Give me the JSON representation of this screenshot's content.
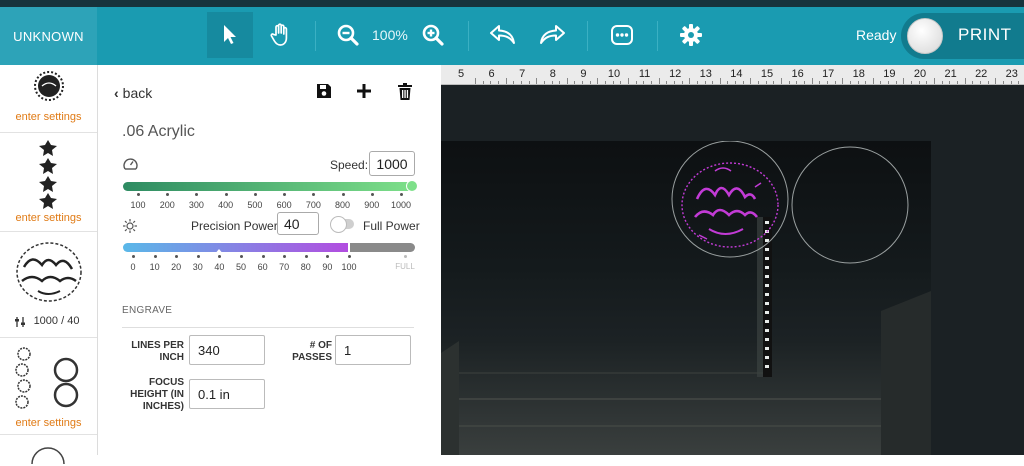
{
  "toolbar": {
    "machine_name": "UNKNOWN",
    "zoom_level": "100%",
    "status": "Ready",
    "print_label": "PRINT",
    "icons": [
      "select-arrow-icon",
      "hand-pan-icon",
      "zoom-out-icon",
      "zoom-in-icon",
      "undo-icon",
      "redo-icon",
      "more-icon",
      "gear-icon"
    ]
  },
  "thumbnails": [
    {
      "caption": "enter settings"
    },
    {
      "caption": "enter settings"
    },
    {
      "caption": "1000 / 40"
    },
    {
      "caption": "enter settings"
    }
  ],
  "panel": {
    "back_label": "back",
    "material": ".06 Acrylic",
    "speed_label": "Speed:",
    "speed_value": "1000",
    "speed_ticks": [
      "100",
      "200",
      "300",
      "400",
      "500",
      "600",
      "700",
      "800",
      "900",
      "1000"
    ],
    "speed_fraction": 1.0,
    "power_label": "Precision Power",
    "power_value": "40",
    "power_fraction": 0.4,
    "power_ticks": [
      "0",
      "10",
      "20",
      "30",
      "40",
      "50",
      "60",
      "70",
      "80",
      "90",
      "100"
    ],
    "power_full_tick": "FULL",
    "full_power_label": "Full Power",
    "engrave_header": "ENGRAVE",
    "lines_per_inch_label": "LINES PER INCH",
    "lines_per_inch_value": "340",
    "passes_label": "# OF PASSES",
    "passes_value": "1",
    "focus_height_label": "FOCUS HEIGHT (IN INCHES)",
    "focus_height_value": "0.1 in",
    "colors": {
      "speed_start": "#2e8b62",
      "speed_end": "#7ee08a",
      "power_start": "#5ab8e8",
      "power_end": "#b24de0"
    }
  },
  "ruler": {
    "numbers": [
      "5",
      "6",
      "7",
      "8",
      "9",
      "10",
      "11",
      "12",
      "13",
      "14",
      "15",
      "16",
      "17",
      "18",
      "19",
      "20",
      "21",
      "22",
      "23"
    ]
  },
  "canvas": {
    "design_color": "#c23bd6",
    "design_text": "Merry Christmas"
  }
}
